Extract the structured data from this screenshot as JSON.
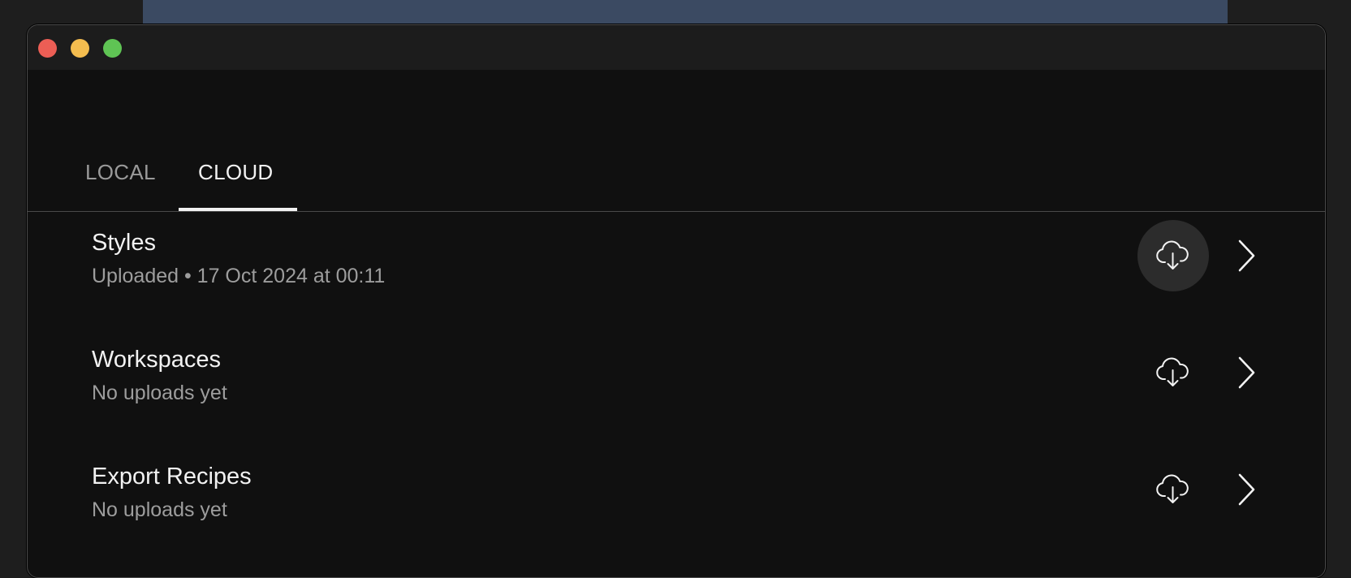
{
  "tabs": [
    {
      "label": "LOCAL",
      "active": false
    },
    {
      "label": "CLOUD",
      "active": true
    }
  ],
  "rows": [
    {
      "title": "Styles",
      "status": "Uploaded • 17 Oct 2024 at 00:11",
      "icon": "cloud-download-icon",
      "highlighted": true
    },
    {
      "title": "Workspaces",
      "status": "No uploads yet",
      "icon": "cloud-download-icon",
      "highlighted": false
    },
    {
      "title": "Export Recipes",
      "status": "No uploads yet",
      "icon": "cloud-download-icon",
      "highlighted": false
    }
  ],
  "colors": {
    "window_bg": "#101010",
    "titlebar_bg": "#1c1c1c",
    "text_primary": "#f2f2f2",
    "text_secondary": "#9d9d9d",
    "close": "#ec5e55",
    "minimize": "#f4bd4f",
    "maximize": "#5fc454"
  }
}
